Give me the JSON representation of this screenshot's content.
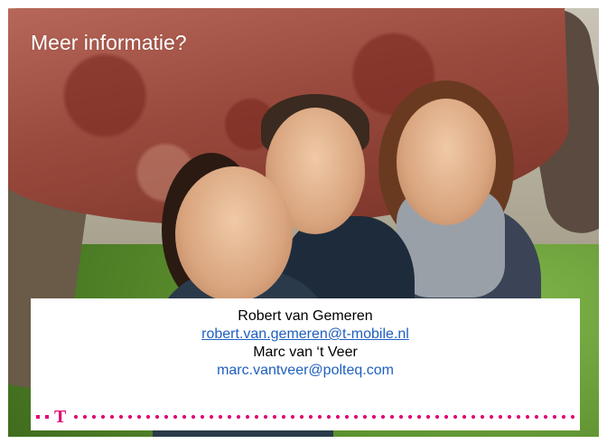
{
  "title": "Meer informatie?",
  "contacts": [
    {
      "name": "Robert van Gemeren",
      "email": "robert.van.gemeren@t-mobile.nl"
    },
    {
      "name": "Marc van ‘t Veer",
      "email": "marc.vantveer@polteq.com"
    }
  ],
  "brand": {
    "logo_letter": "T",
    "accent_color": "#e20074",
    "link_color": "#1f5fbf"
  }
}
